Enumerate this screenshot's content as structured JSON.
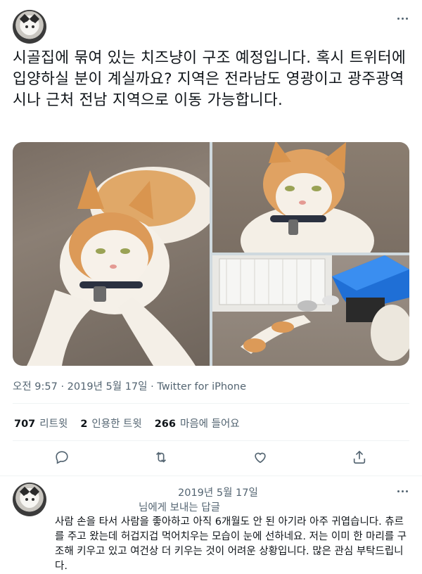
{
  "tweet": {
    "text": "시골집에 묶여 있는 치즈냥이 구조 예정입니다. 혹시 트위터에 입양하실 분이 계실까요? 지역은 전라남도 영광이고 광주광역시나 근처 전남 지역으로 이동 가능합니다.",
    "timestamp": "오전 9:57 · 2019년 5월 17일 · ",
    "source": "Twitter for iPhone"
  },
  "stats": {
    "retweets_count": "707",
    "retweets_label": "리트윗",
    "quotes_count": "2",
    "quotes_label": "인용한 트윗",
    "likes_count": "266",
    "likes_label": "마음에 들어요"
  },
  "reply": {
    "date": "2019년 5월 17일",
    "replying_to": "님에게 보내는 답글",
    "text": "사람 손을 타서 사람을 좋아하고 아직 6개월도 안 된 아기라 아주 귀엽습니다. 츄르를 주고 왔는데 허겁지겁 먹어치우는 모습이 눈에 선하네요. 저는 이미 한 마리를 구조해 키우고 있고 여건상 더 키우는 것이 어려운 상황입니다. 많은 관심 부탁드립니다."
  },
  "colors": {
    "text": "#0f1419",
    "secondary": "#536471",
    "link": "#1d9bf0",
    "divider": "#eff3f4"
  },
  "icons": [
    "more-icon",
    "reply-icon",
    "retweet-icon",
    "like-icon",
    "share-icon"
  ]
}
